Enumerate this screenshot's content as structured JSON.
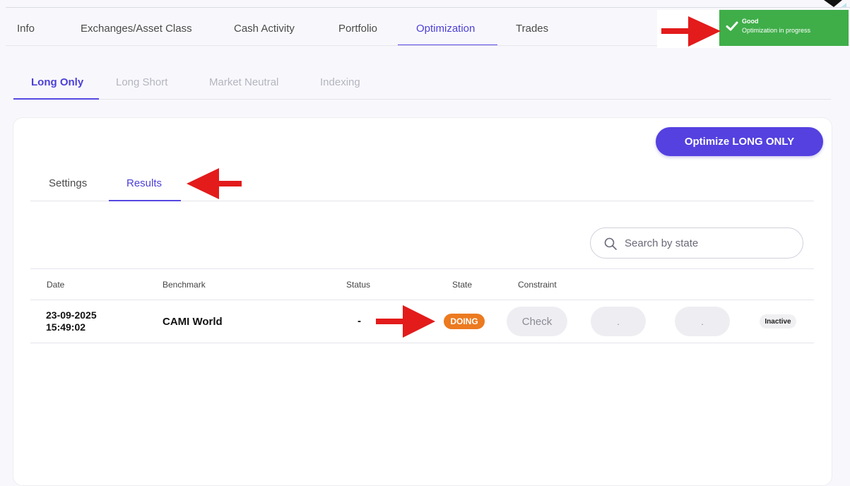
{
  "main_tabs": [
    {
      "label": "Info"
    },
    {
      "label": "Exchanges/Asset Class"
    },
    {
      "label": "Cash Activity"
    },
    {
      "label": "Portfolio"
    },
    {
      "label": "Optimization",
      "active": true
    },
    {
      "label": "Trades"
    }
  ],
  "toast": {
    "title": "Good",
    "message": "Optimization in progress",
    "color": "#3fae49",
    "icon": "check-icon"
  },
  "sub_tabs": [
    {
      "label": "Long Only",
      "active": true
    },
    {
      "label": "Long Short"
    },
    {
      "label": "Market Neutral"
    },
    {
      "label": "Indexing"
    }
  ],
  "optimize_button": {
    "label": "Optimize LONG ONLY",
    "color": "#5441e0"
  },
  "inner_tabs": [
    {
      "label": "Settings"
    },
    {
      "label": "Results",
      "active": true
    }
  ],
  "search": {
    "placeholder": "Search by state",
    "value": "",
    "icon": "search-icon"
  },
  "table": {
    "headers": {
      "date": "Date",
      "benchmark": "Benchmark",
      "status": "Status",
      "state": "State",
      "constraint": "Constraint"
    },
    "rows": [
      {
        "date": "23-09-2025",
        "time": "15:49:02",
        "benchmark": "CAMI World",
        "status": "-",
        "state": "DOING",
        "constraint": "Check",
        "action1": ".",
        "action2": ".",
        "active": "Inactive"
      }
    ]
  },
  "accent_color": "#5548e0",
  "annotation_color": "#e31b1b"
}
